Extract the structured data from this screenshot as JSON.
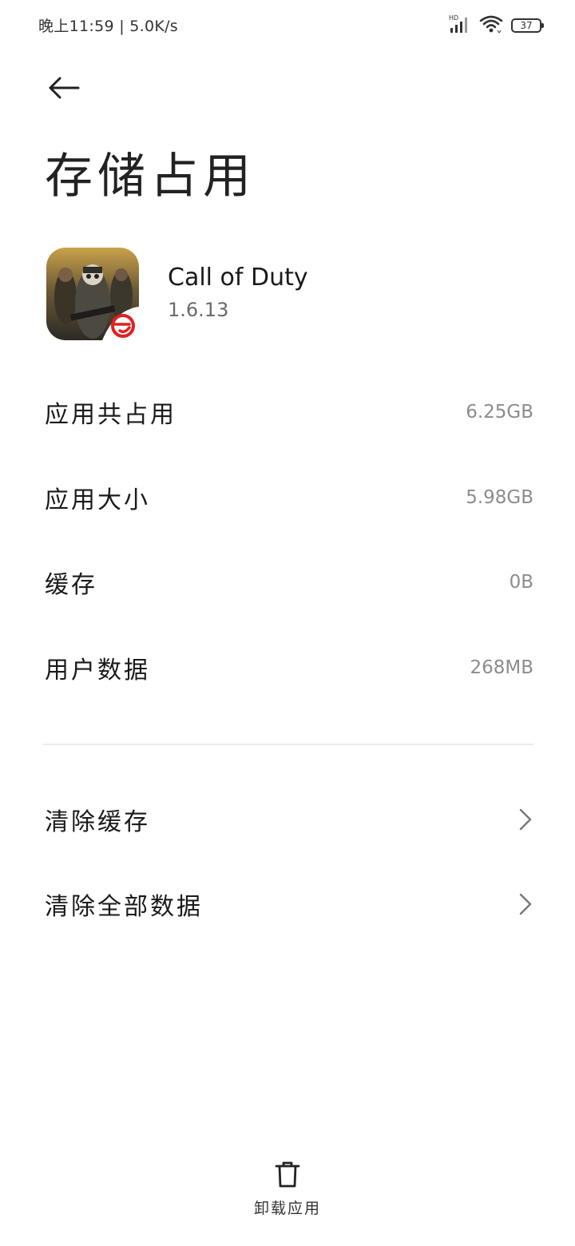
{
  "status_bar": {
    "time_speed": "晚上11:59 | 5.0K/s",
    "network_badge": "HD",
    "battery_level": "37",
    "icons": [
      "signal-icon",
      "wifi-icon",
      "battery-icon"
    ]
  },
  "header": {
    "back_icon": "arrow-left-icon",
    "title": "存储占用"
  },
  "app": {
    "name": "Call of Duty",
    "version": "1.6.13",
    "icon": "app-icon"
  },
  "storage": {
    "rows": [
      {
        "label": "应用共占用",
        "value": "6.25GB"
      },
      {
        "label": "应用大小",
        "value": "5.98GB"
      },
      {
        "label": "缓存",
        "value": "0B"
      },
      {
        "label": "用户数据",
        "value": "268MB"
      }
    ]
  },
  "actions": {
    "items": [
      {
        "label": "清除缓存",
        "icon": "chevron-right-icon"
      },
      {
        "label": "清除全部数据",
        "icon": "chevron-right-icon"
      }
    ]
  },
  "bottom": {
    "uninstall_label": "卸载应用",
    "icon": "trash-icon"
  },
  "colors": {
    "background": "#ffffff",
    "text_primary": "#1a1a1a",
    "text_secondary": "#8c8c8c",
    "divider": "#ececec"
  }
}
